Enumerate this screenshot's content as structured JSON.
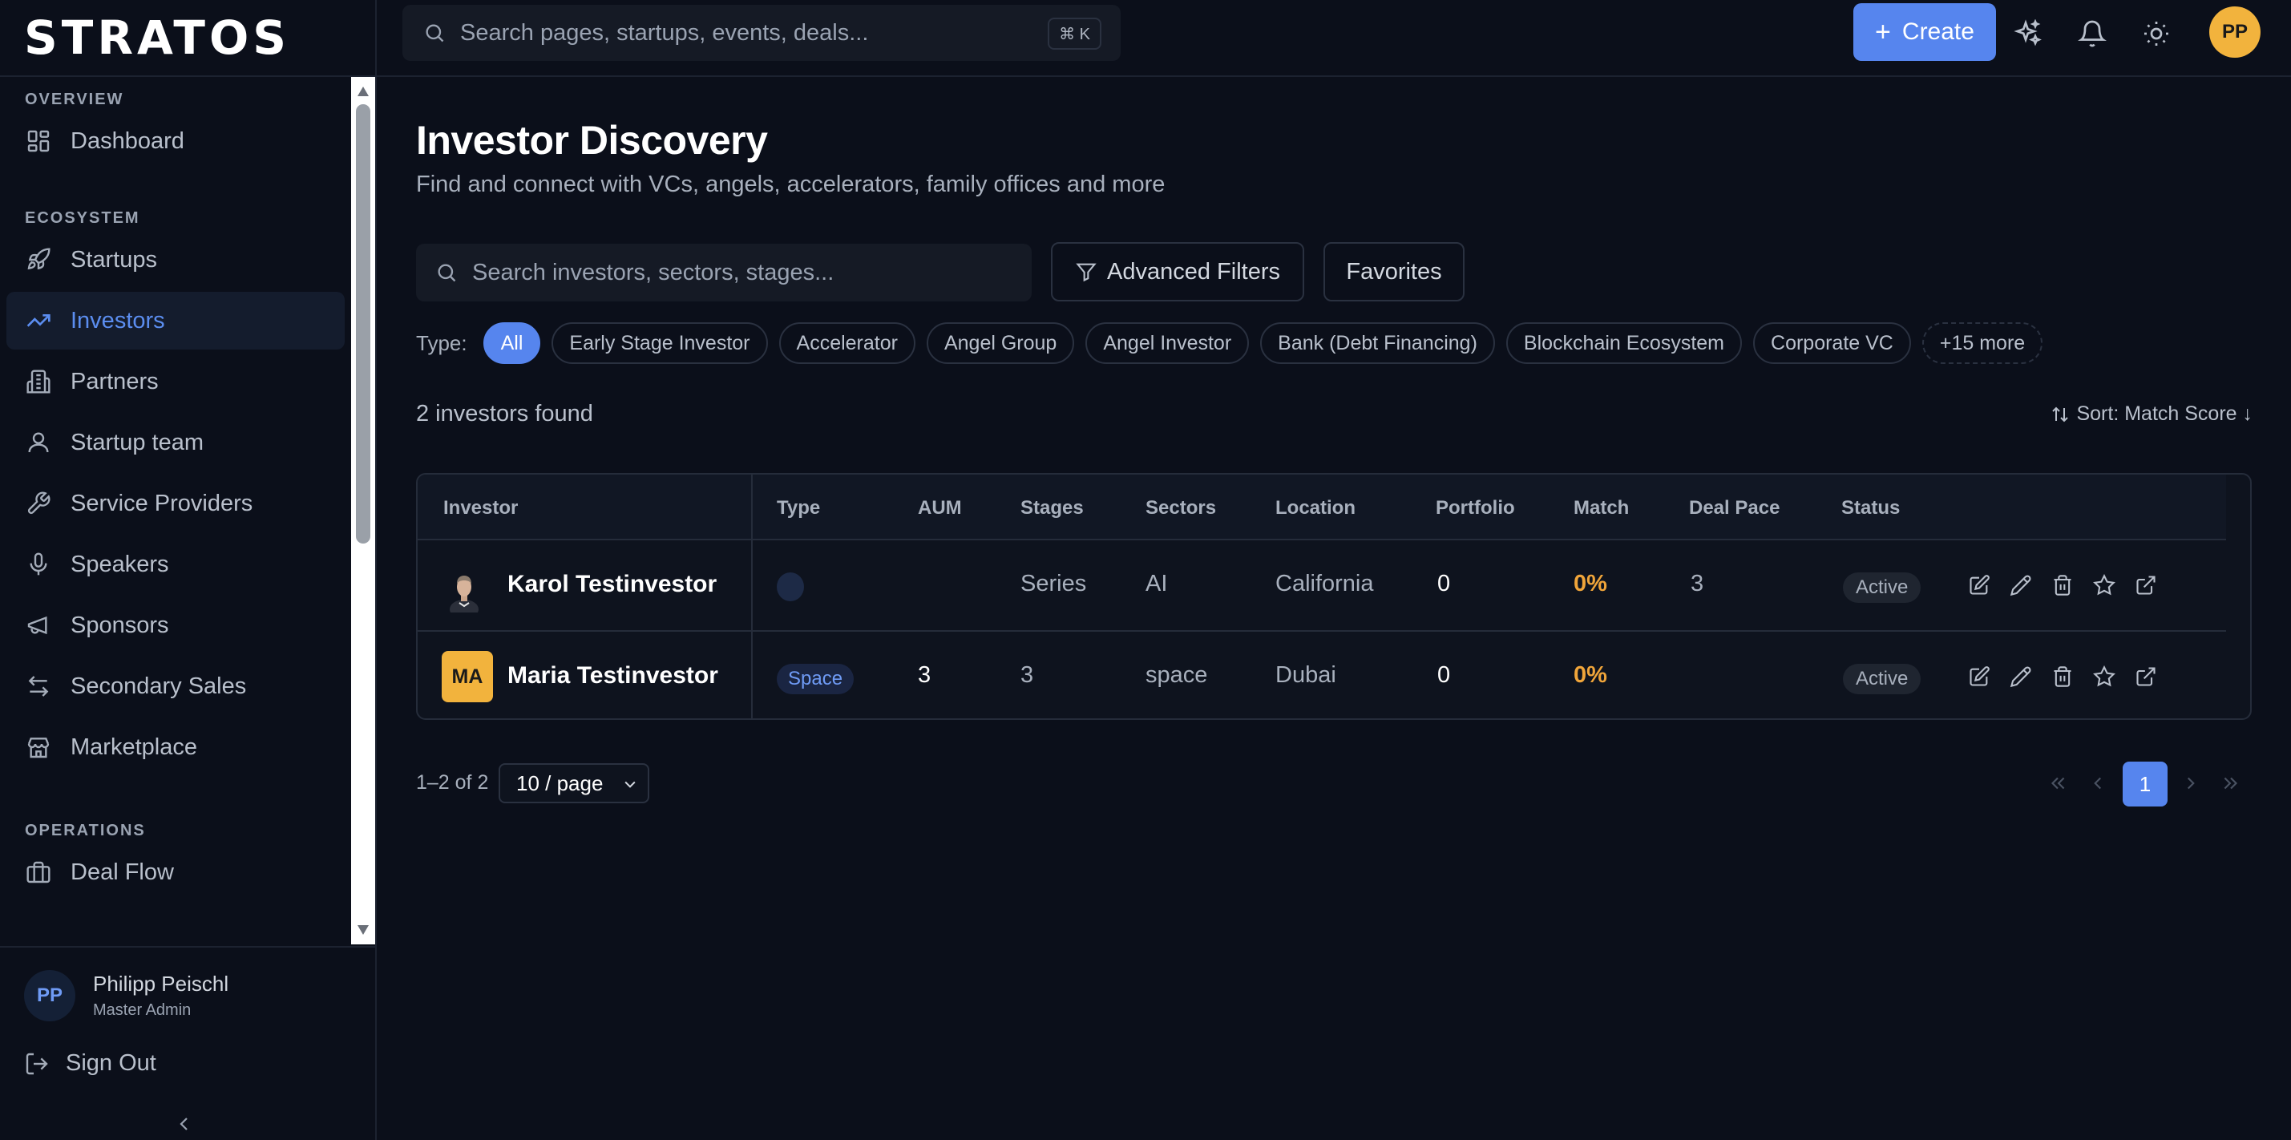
{
  "brand": {
    "logo": "STRATOS"
  },
  "sidebar": {
    "sections": [
      {
        "label": "OVERVIEW",
        "items": [
          {
            "label": "Dashboard",
            "icon": "dashboard-icon"
          }
        ]
      },
      {
        "label": "ECOSYSTEM",
        "items": [
          {
            "label": "Startups",
            "icon": "rocket-icon"
          },
          {
            "label": "Investors",
            "icon": "trending-up-icon",
            "active": true
          },
          {
            "label": "Partners",
            "icon": "building-icon"
          },
          {
            "label": "Startup team",
            "icon": "user-icon"
          },
          {
            "label": "Service Providers",
            "icon": "wrench-icon"
          },
          {
            "label": "Speakers",
            "icon": "microphone-icon"
          },
          {
            "label": "Sponsors",
            "icon": "megaphone-icon"
          },
          {
            "label": "Secondary Sales",
            "icon": "arrows-swap-icon"
          },
          {
            "label": "Marketplace",
            "icon": "store-icon"
          }
        ]
      },
      {
        "label": "OPERATIONS",
        "items": [
          {
            "label": "Deal Flow",
            "icon": "briefcase-icon"
          }
        ]
      }
    ],
    "user": {
      "initials": "PP",
      "name": "Philipp Peischl",
      "role": "Master Admin"
    },
    "sign_out": "Sign Out"
  },
  "topbar": {
    "search_placeholder": "Search pages, startups, events, deals...",
    "shortcut": "⌘ K",
    "create_label": "Create",
    "avatar_initials": "PP"
  },
  "page": {
    "title": "Investor Discovery",
    "subtitle": "Find and connect with VCs, angels, accelerators, family offices and more"
  },
  "filters": {
    "search_placeholder": "Search investors, sectors, stages...",
    "advanced_label": "Advanced Filters",
    "favorites_label": "Favorites",
    "type_label": "Type:",
    "chips": [
      "All",
      "Early Stage Investor",
      "Accelerator",
      "Angel Group",
      "Angel Investor",
      "Bank (Debt Financing)",
      "Blockchain Ecosystem",
      "Corporate VC"
    ],
    "more_label": "+15 more"
  },
  "results": {
    "count_label": "2 investors found",
    "sort_label": "Sort: Match Score ↓"
  },
  "table": {
    "columns": [
      "Investor",
      "Type",
      "AUM",
      "Stages",
      "Sectors",
      "Location",
      "Portfolio",
      "Match",
      "Deal Pace",
      "Status"
    ],
    "rows": [
      {
        "name": "Karol Testinvestor",
        "avatar": "photo",
        "type": "",
        "aum": "",
        "stages": "Series",
        "sectors": "AI",
        "location": "California",
        "portfolio": "0",
        "match": "0%",
        "deal_pace": "3",
        "status": "Active"
      },
      {
        "name": "Maria Testinvestor",
        "avatar_initials": "MA",
        "type": "Space",
        "aum": "3",
        "stages": "3",
        "sectors": "space",
        "location": "Dubai",
        "portfolio": "0",
        "match": "0%",
        "deal_pace": "",
        "status": "Active"
      }
    ]
  },
  "pagination": {
    "range_label": "1–2 of 2",
    "page_size_label": "10 / page",
    "current_page": "1"
  },
  "colors": {
    "background": "#0b0f1a",
    "accent": "#5685ee",
    "match": "#f0a53a",
    "avatar": "#f2b33d"
  }
}
